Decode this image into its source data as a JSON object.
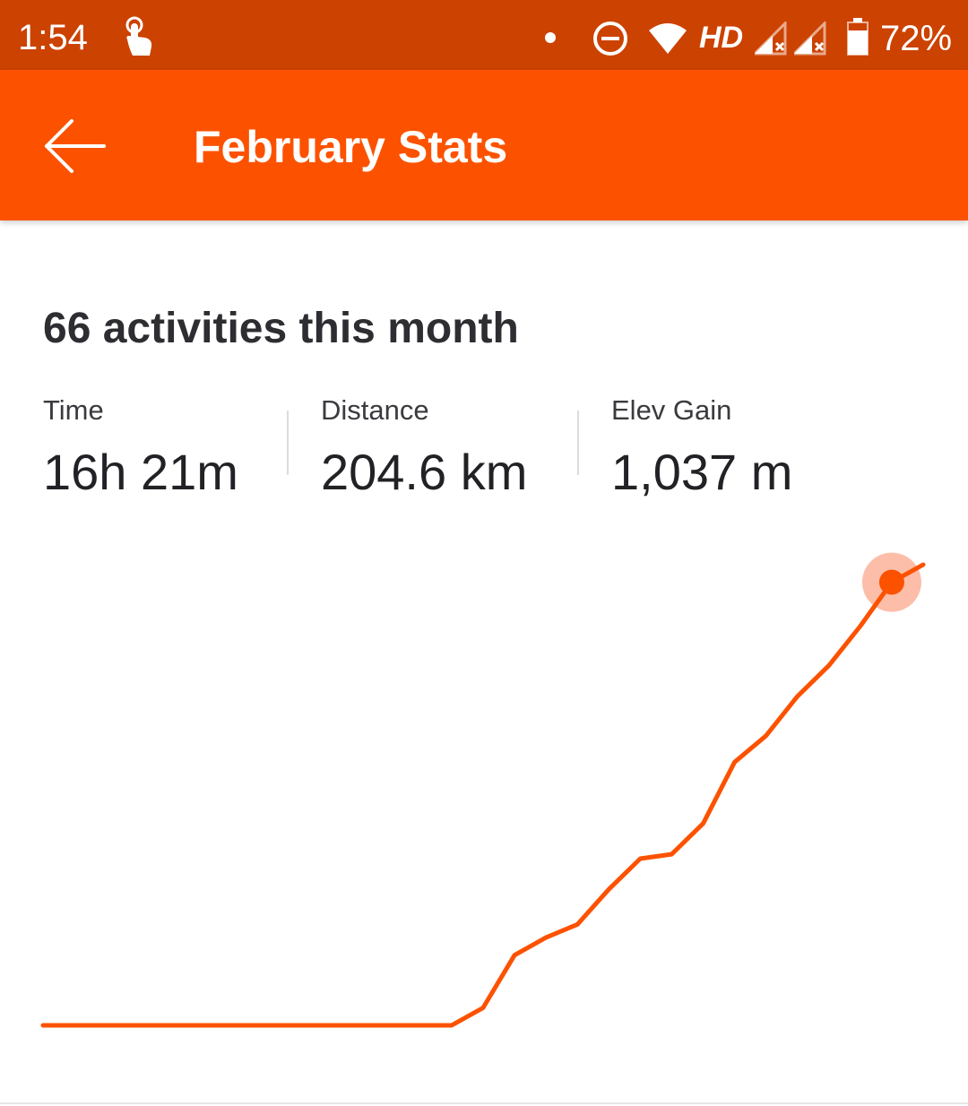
{
  "status_bar": {
    "time": "1:54",
    "network_label": "HD",
    "battery": "72%"
  },
  "app_bar": {
    "title": "February Stats"
  },
  "summary": {
    "title": "66 activities this month",
    "stats": [
      {
        "label": "Time",
        "value": "16h 21m"
      },
      {
        "label": "Distance",
        "value": "204.6 km"
      },
      {
        "label": "Elev Gain",
        "value": "1,037 m"
      }
    ]
  },
  "colors": {
    "status_bar": "#CC4200",
    "accent": "#FC5200",
    "marker_halo": "#FDB39A"
  },
  "chart_data": {
    "type": "line",
    "series": [
      {
        "values": [
          0,
          0,
          0,
          0,
          0,
          0,
          0,
          0,
          0,
          0,
          0,
          0,
          0,
          0,
          4,
          16,
          20,
          23,
          31,
          38,
          39,
          46,
          60,
          66,
          75,
          82,
          91,
          101,
          105
        ]
      }
    ],
    "ylim": [
      0,
      105
    ],
    "grid": false,
    "highlight_index": 27
  }
}
